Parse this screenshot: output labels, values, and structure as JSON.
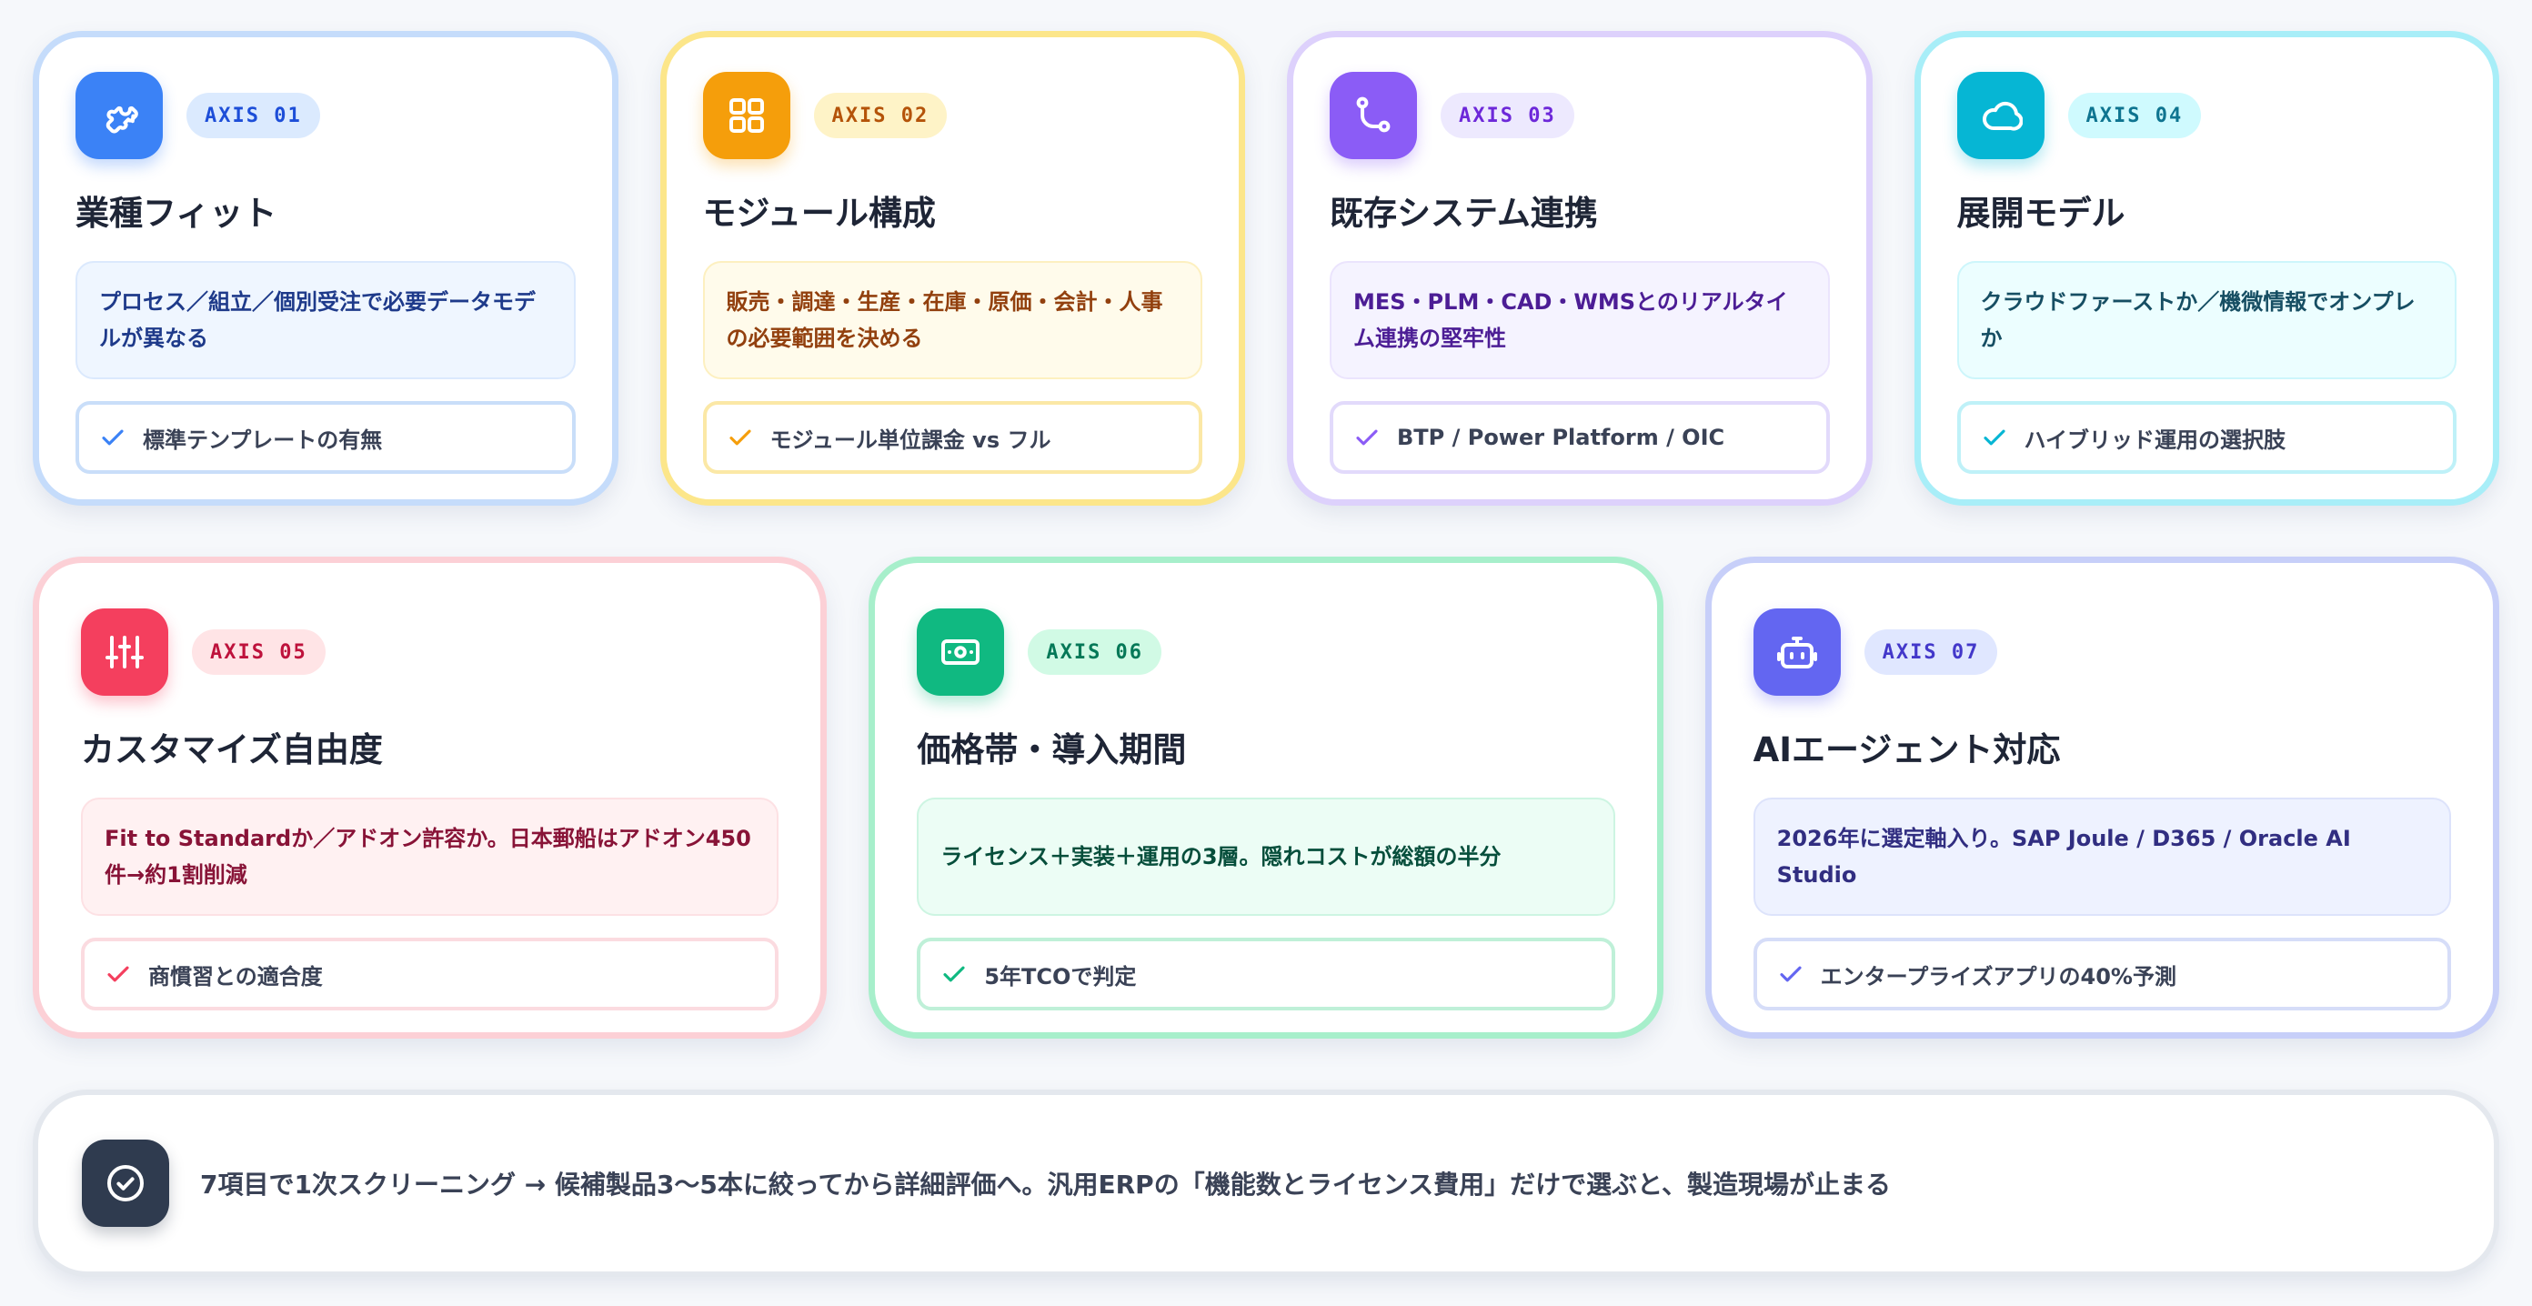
{
  "cards": [
    {
      "badge": "AXIS 01",
      "title": "業種フィット",
      "description": "プロセス／組立／個別受注で必要データモデルが異なる",
      "check": "標準テンプレートの有無",
      "icon": "puzzle-icon",
      "accent": "#3b82f6"
    },
    {
      "badge": "AXIS 02",
      "title": "モジュール構成",
      "description": "販売・調達・生産・在庫・原価・会計・人事の必要範囲を決める",
      "check": "モジュール単位課金 vs フル",
      "icon": "grid-icon",
      "accent": "#f59e0b"
    },
    {
      "badge": "AXIS 03",
      "title": "既存システム連携",
      "description": "MES・PLM・CAD・WMSとのリアルタイム連携の堅牢性",
      "check": "BTP / Power Platform / OIC",
      "icon": "git-branch-icon",
      "accent": "#8b5cf6"
    },
    {
      "badge": "AXIS 04",
      "title": "展開モデル",
      "description": "クラウドファーストか／機微情報でオンプレか",
      "check": "ハイブリッド運用の選択肢",
      "icon": "cloud-icon",
      "accent": "#06b6d4"
    },
    {
      "badge": "AXIS 05",
      "title": "カスタマイズ自由度",
      "description": "Fit to Standardか／アドオン許容か。日本郵船はアドオン450件→約1割削減",
      "check": "商慣習との適合度",
      "icon": "sliders-icon",
      "accent": "#f43f5e"
    },
    {
      "badge": "AXIS 06",
      "title": "価格帯・導入期間",
      "description": "ライセンス＋実装＋運用の3層。隠れコストが総額の半分",
      "check": "5年TCOで判定",
      "icon": "banknote-icon",
      "accent": "#10b981"
    },
    {
      "badge": "AXIS 07",
      "title": "AIエージェント対応",
      "description": "2026年に選定軸入り。SAP Joule / D365 / Oracle AI Studio",
      "check": "エンタープライズアプリの40%予測",
      "icon": "bot-icon",
      "accent": "#6366f1"
    }
  ],
  "footer": {
    "text": "7項目で1次スクリーニング → 候補製品3〜5本に絞ってから詳細評価へ。汎用ERPの「機能数とライセンス費用」だけで選ぶと、製造現場が止まる",
    "icon": "check-circle-icon"
  }
}
